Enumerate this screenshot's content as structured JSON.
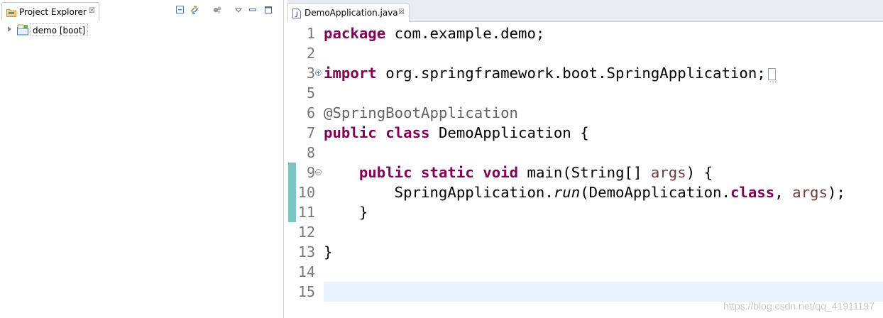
{
  "explorer": {
    "tab_label": "Project Explorer",
    "close_glyph": "☒",
    "toolbar_icons": [
      "collapse-all-icon",
      "link-with-editor-icon",
      "filters-icon",
      "view-menu-icon",
      "minimize-icon",
      "maximize-icon"
    ],
    "tree": [
      {
        "label": "demo [boot]",
        "expanded": false,
        "icon": "spring-boot-project-icon"
      }
    ]
  },
  "editor": {
    "tab": {
      "label": "DemoApplication.java",
      "close_glyph": "☒",
      "icon": "java-file-icon"
    },
    "current_line": 15,
    "lines": [
      {
        "n": "1",
        "parts": [
          {
            "t": "package",
            "c": "kw"
          },
          {
            "t": " com.example.demo;"
          }
        ]
      },
      {
        "n": "2",
        "parts": []
      },
      {
        "n": "3",
        "fold": "collapsed",
        "folded_block": true,
        "parts": [
          {
            "t": "import",
            "c": "kw"
          },
          {
            "t": " org.springframework.boot.SpringApplication;"
          }
        ]
      },
      {
        "n": "5",
        "parts": []
      },
      {
        "n": "6",
        "parts": [
          {
            "t": "@SpringBootApplication",
            "c": "ann"
          }
        ]
      },
      {
        "n": "7",
        "parts": [
          {
            "t": "public",
            "c": "kw"
          },
          {
            "t": " "
          },
          {
            "t": "class",
            "c": "kw"
          },
          {
            "t": " DemoApplication {"
          }
        ]
      },
      {
        "n": "8",
        "parts": []
      },
      {
        "n": "9",
        "fold": "expanded",
        "parts": [
          {
            "t": "    "
          },
          {
            "t": "public",
            "c": "kw"
          },
          {
            "t": " "
          },
          {
            "t": "static",
            "c": "kw"
          },
          {
            "t": " "
          },
          {
            "t": "void",
            "c": "kw"
          },
          {
            "t": " main(String[] "
          },
          {
            "t": "args",
            "c": "param"
          },
          {
            "t": ") {"
          }
        ]
      },
      {
        "n": "10",
        "parts": [
          {
            "t": "        SpringApplication."
          },
          {
            "t": "run",
            "c": "it"
          },
          {
            "t": "(DemoApplication."
          },
          {
            "t": "class",
            "c": "kw"
          },
          {
            "t": ", "
          },
          {
            "t": "args",
            "c": "param"
          },
          {
            "t": ");"
          }
        ]
      },
      {
        "n": "11",
        "parts": [
          {
            "t": "    }"
          }
        ]
      },
      {
        "n": "12",
        "parts": []
      },
      {
        "n": "13",
        "parts": [
          {
            "t": "}"
          }
        ]
      },
      {
        "n": "14",
        "parts": []
      },
      {
        "n": "15",
        "parts": []
      }
    ]
  },
  "watermark": "https://blog.csdn.net/qq_41911197",
  "colors": {
    "keyword": "#7f0055",
    "annotation": "#646464",
    "parameter": "#6a3e3e",
    "line_number": "#787878",
    "current_line_bg": "#e8f2fe",
    "change_bar": "#7ec3c3"
  }
}
